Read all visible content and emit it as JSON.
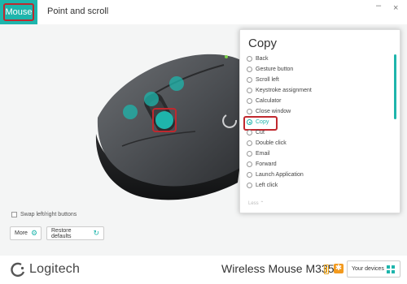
{
  "tabs": [
    {
      "label": "Mouse",
      "active": true
    },
    {
      "label": "Point and scroll",
      "active": false
    }
  ],
  "window_controls": {
    "minimize": "–",
    "close": "×"
  },
  "panel": {
    "title": "Copy",
    "options": [
      {
        "label": "Back",
        "selected": false
      },
      {
        "label": "Gesture button",
        "selected": false
      },
      {
        "label": "Scroll left",
        "selected": false
      },
      {
        "label": "Keystroke assignment",
        "selected": false
      },
      {
        "label": "Calculator",
        "selected": false
      },
      {
        "label": "Close window",
        "selected": false
      },
      {
        "label": "Copy",
        "selected": true
      },
      {
        "label": "Cut",
        "selected": false
      },
      {
        "label": "Double click",
        "selected": false
      },
      {
        "label": "Email",
        "selected": false
      },
      {
        "label": "Forward",
        "selected": false
      },
      {
        "label": "Launch Application",
        "selected": false
      },
      {
        "label": "Left click",
        "selected": false
      }
    ],
    "less_label": "Less ⌃"
  },
  "controls": {
    "swap_label": "Swap left/right buttons",
    "more_label": "More",
    "restore_label": "Restore defaults"
  },
  "footer": {
    "brand": "Logitech",
    "device": "Wireless Mouse M335",
    "your_devices": "Your devices",
    "unifying_icon": "✱"
  },
  "colors": {
    "accent": "#1eb5ac",
    "highlight": "#c0282e",
    "battery": "#e8a21c"
  },
  "icons": {
    "more": "gear-icon",
    "restore": "restore-icon",
    "devices": "grid-icon"
  }
}
